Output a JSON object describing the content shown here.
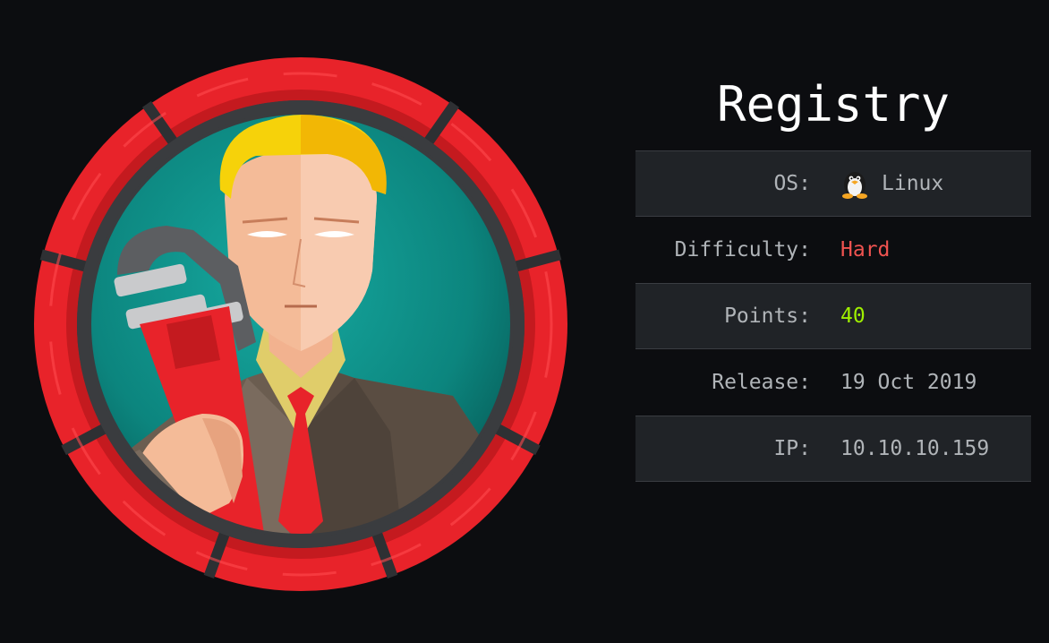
{
  "machine": {
    "name": "Registry",
    "avatar_icon": "wrench-businessman-avatar",
    "ring_color": "#e8232a"
  },
  "info": {
    "os_label": "OS:",
    "os_icon": "linux-penguin-icon",
    "os_value": "Linux",
    "difficulty_label": "Difficulty:",
    "difficulty_value": "Hard",
    "difficulty_color": "#ef5350",
    "points_label": "Points:",
    "points_value": "40",
    "points_color": "#9fef00",
    "release_label": "Release:",
    "release_value": "19 Oct 2019",
    "ip_label": "IP:",
    "ip_value": "10.10.10.159"
  }
}
